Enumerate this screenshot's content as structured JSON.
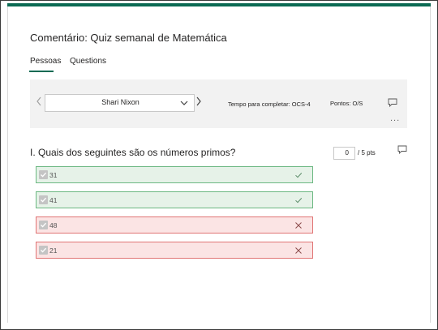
{
  "header": {
    "title": "Comentário: Quiz semanal de Matemática"
  },
  "tabs": [
    {
      "label": "Pessoas",
      "active": true
    },
    {
      "label": "Questions",
      "active": false
    }
  ],
  "respondent_bar": {
    "selected_person": "Shari Nixon",
    "time_to_complete": "Tempo para completar: OCS-4",
    "points": "Pontos: O/S",
    "more_label": "..."
  },
  "question": {
    "text": "I. Quais dos seguintes são os números primos?",
    "score_value": "0",
    "score_total": "/ 5 pts"
  },
  "options": [
    {
      "label": "31",
      "status": "correct"
    },
    {
      "label": "41",
      "status": "correct"
    },
    {
      "label": "48",
      "status": "wrong"
    },
    {
      "label": "21",
      "status": "wrong"
    }
  ],
  "colors": {
    "accent": "#0b6a53",
    "correct_bg": "#e6f2e8",
    "correct_border": "#6cb882",
    "wrong_bg": "#fbe4e4",
    "wrong_border": "#e07575"
  },
  "icons": {
    "prev": "chevron-left-icon",
    "next": "chevron-right-icon",
    "dropdown": "chevron-down-icon",
    "comment": "comment-icon",
    "checkbox": "checkbox-checked-icon",
    "correct": "check-icon",
    "wrong": "x-icon"
  }
}
